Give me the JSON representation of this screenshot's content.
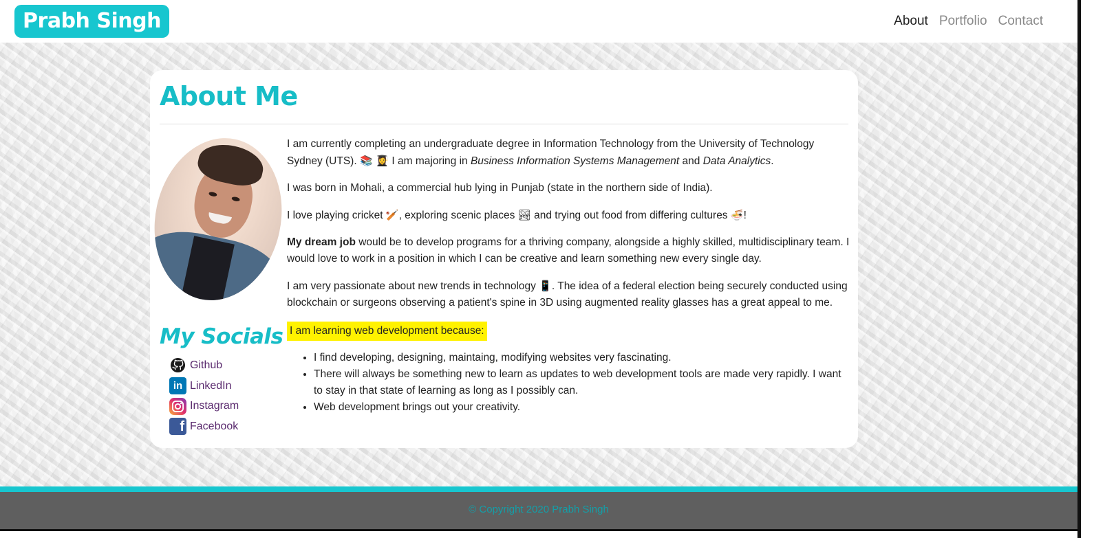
{
  "nav": {
    "brand": "Prabh Singh",
    "links": [
      "About",
      "Portfolio",
      "Contact"
    ],
    "active_link": "About"
  },
  "about": {
    "title": "About Me",
    "p1_start": "I am currently completing an undergraduate degree in Information Technology from the University of Technology Sydney (UTS).",
    "p1_emoji": "📚 👩‍🎓",
    "p1_mid": "I am majoring in",
    "p1_major1": "Business Information Systems Management",
    "p1_and": "and",
    "p1_major2": "Data Analytics",
    "p1_end": ".",
    "p2": "I was born in Mohali, a commercial hub lying in Punjab (state in the northern side of India).",
    "p3_a": "I love playing cricket",
    "p3_emoji1": "🏏",
    "p3_b": ", exploring scenic places",
    "p3_emoji2": "🏞",
    "p3_c": "and trying out food from differing cultures",
    "p3_emoji3": "🍜",
    "p3_d": "!",
    "p4_bold": "My dream job",
    "p4_rest": "would be to develop programs for a thriving company, alongside a highly skilled, multidisciplinary team. I would love to work in a position in which I can be creative and learn something new every single day.",
    "p5_a": "I am very passionate about new trends in technology",
    "p5_emoji": "📱",
    "p5_b": ". The idea of a federal election being securely conducted using blockchain or surgeons observing a patient's spine in 3D using augmented reality glasses has a great appeal to me.",
    "highlight": "I am learning web development because:",
    "reasons": [
      "I find developing, designing, maintaing, modifying websites very fascinating.",
      "There will always be something new to learn as updates to web development tools are made very rapidly. I want to stay in that state of learning as long as I possibly can.",
      "Web development brings out your creativity."
    ]
  },
  "socials": {
    "title": "My Socials",
    "items": [
      {
        "label": "Github",
        "icon": "github-icon"
      },
      {
        "label": "LinkedIn",
        "icon": "linkedin-icon"
      },
      {
        "label": "Instagram",
        "icon": "instagram-icon"
      },
      {
        "label": "Facebook",
        "icon": "facebook-icon"
      }
    ]
  },
  "footer": {
    "copyright": "© Copyright 2020 Prabh Singh"
  },
  "colors": {
    "accent": "#17c6cf",
    "highlight": "#fff200",
    "footer_bg": "#5f5f5f",
    "link": "#5a2a6e"
  }
}
